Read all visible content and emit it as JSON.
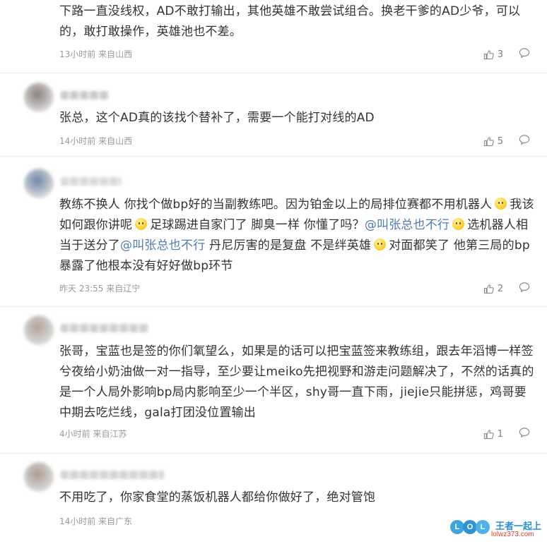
{
  "comments": [
    {
      "text_segments": [
        {
          "type": "text",
          "value": "下路一直没线权，AD不敢打输出，其他英雄不敢尝试组合。换老干爹的AD少爷，可以的，敢打敢操作，英雄池也不差。"
        }
      ],
      "meta": "13小时前 来自山西",
      "likes": "3",
      "avatar_color": "#b9b9b9",
      "name_color": "#c9c9c9"
    },
    {
      "text_segments": [
        {
          "type": "text",
          "value": "张总，这个AD真的该找个替补了，需要一个能打对线的AD"
        }
      ],
      "meta": "14小时前 来自山西",
      "likes": "5",
      "avatar_color": "#8a7f7a",
      "name_color": "#bdbdbd"
    },
    {
      "text_segments": [
        {
          "type": "text",
          "value": "教练不换人 你找个做bp好的当副教练吧。因为铂金以上的局排位赛都不用机器人"
        },
        {
          "type": "emoji",
          "value": "smile-emoji"
        },
        {
          "type": "text",
          "value": "我该如何跟你讲呢"
        },
        {
          "type": "emoji",
          "value": "smile-emoji"
        },
        {
          "type": "text",
          "value": "足球踢进自家门了 脚臭一样 你懂了吗？"
        },
        {
          "type": "mention",
          "value": "@叫张总也不行"
        },
        {
          "type": "emoji",
          "value": "smile-emoji"
        },
        {
          "type": "text",
          "value": "选机器人相当于送分了"
        },
        {
          "type": "mention",
          "value": "@叫张总也不行"
        },
        {
          "type": "text",
          "value": " 丹尼厉害的是复盘 不是绊英雄"
        },
        {
          "type": "emoji",
          "value": "laugh-emoji"
        },
        {
          "type": "text",
          "value": "对面都笑了 他第三局的bp暴露了他根本没有好好做bp环节"
        }
      ],
      "meta": "昨天 23:55 来自辽宁",
      "likes": "2",
      "avatar_color": "#6a86a6",
      "name_color": "#d0d0d0"
    },
    {
      "text_segments": [
        {
          "type": "text",
          "value": "张哥，宝蓝也是签的你们氧望么，如果是的话可以把宝蓝签来教练组，跟去年滔博一样签兮夜给小奶油做一对一指导，至少要让meiko先把视野和游走问题解决了，不然的话真的是一个人局外影响bp局内影响至少一个半区，shy哥一直下雨，jiejie只能拼惩，鸡哥要中期去吃烂线，gala打团没位置输出"
        }
      ],
      "meta": "4小时前 来自江苏",
      "likes": "1",
      "avatar_color": "#b0a499",
      "name_color": "#c4c4c4"
    },
    {
      "text_segments": [
        {
          "type": "text",
          "value": "不用吃了，你家食堂的蒸饭机器人都给你做好了，绝对管饱"
        }
      ],
      "meta": "14小时前 来自广东",
      "likes": "",
      "avatar_color": "#a99c8f",
      "name_color": "#c8c8c8"
    }
  ],
  "watermark": {
    "logo_letters": [
      "L",
      "O",
      "L"
    ],
    "text": "王者一起上",
    "url": "lolwz373.com"
  },
  "colors": {
    "text": "#333333",
    "meta": "#9a9a9a",
    "mention": "#507daf",
    "divider": "#ececec"
  }
}
